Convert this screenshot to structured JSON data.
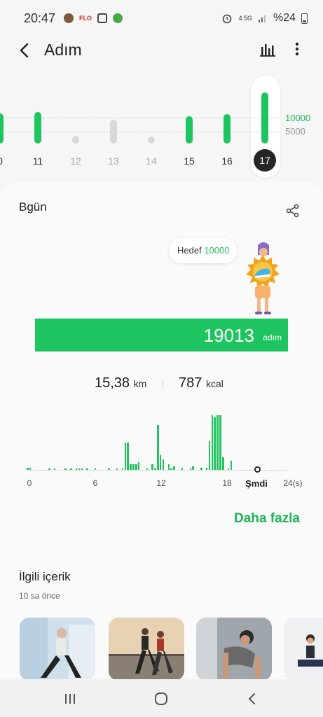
{
  "status_bar": {
    "time": "20:47",
    "flo_label": "FLO",
    "network": "4.5G",
    "battery": "%24"
  },
  "header": {
    "title": "Adım"
  },
  "day_chart": {
    "days": [
      {
        "label": "0",
        "steps": 11500,
        "active": false
      },
      {
        "label": "11",
        "steps": 12000,
        "active": false
      },
      {
        "label": "12",
        "steps": 3100,
        "active": false
      },
      {
        "label": "13",
        "steps": 9300,
        "active": false
      },
      {
        "label": "14",
        "steps": 2800,
        "active": false
      },
      {
        "label": "15",
        "steps": 10600,
        "active": false
      },
      {
        "label": "16",
        "steps": 11200,
        "active": false
      },
      {
        "label": "17",
        "steps": 19013,
        "active": true
      }
    ],
    "goal_label": "10000",
    "half_goal_label": "5000",
    "colors": {
      "met": "#1ec460",
      "unmet": "#d8d8d8",
      "active_label_bg": "#262626"
    }
  },
  "today": {
    "title": "Bgün",
    "target_label": "Hedef",
    "target_value": "10000",
    "steps": "19013",
    "steps_unit": "adım",
    "distance": "15,38",
    "distance_unit": "km",
    "calories": "787",
    "calories_unit": "kcal",
    "more_link": "Daha fazla",
    "progress": 1.0
  },
  "hourly_chart": {
    "ticks": [
      "0",
      "6",
      "12",
      "18",
      "Şmdi",
      "24(s)"
    ],
    "hourly_activity": [
      0.04,
      0.04,
      0,
      0,
      0,
      0,
      0,
      0,
      0.02,
      0,
      0.02,
      0,
      0,
      0,
      0.02,
      0,
      0.02,
      0,
      0.02,
      0.02,
      0.02,
      0,
      0.02,
      0,
      0,
      0.02,
      0,
      0,
      0,
      0,
      0.02,
      0,
      0,
      0.02,
      0,
      0.02,
      0.48,
      0.48,
      0.1,
      0.1,
      0.1,
      0.14,
      0,
      0,
      0.02,
      0,
      0.1,
      0.02,
      0.78,
      0.26,
      0.18,
      0,
      0.1,
      0.02,
      0.06,
      0,
      0,
      0.04,
      0,
      0,
      0.02,
      0.06,
      0,
      0,
      0.04,
      0,
      0.04,
      0.5,
      0.95,
      0.92,
      0.95,
      0.95,
      0.22,
      0,
      0.02,
      0.16,
      0,
      0,
      0,
      0,
      0,
      0,
      0,
      0,
      0,
      0,
      0,
      0,
      0,
      0,
      0,
      0,
      0,
      0,
      0,
      0
    ],
    "now_position": 0.8
  },
  "related": {
    "title": "İlgili içerik",
    "time": "10 sa önce"
  },
  "navbar": {
    "recent": "recents-icon",
    "home": "home-icon",
    "back": "back-icon"
  }
}
